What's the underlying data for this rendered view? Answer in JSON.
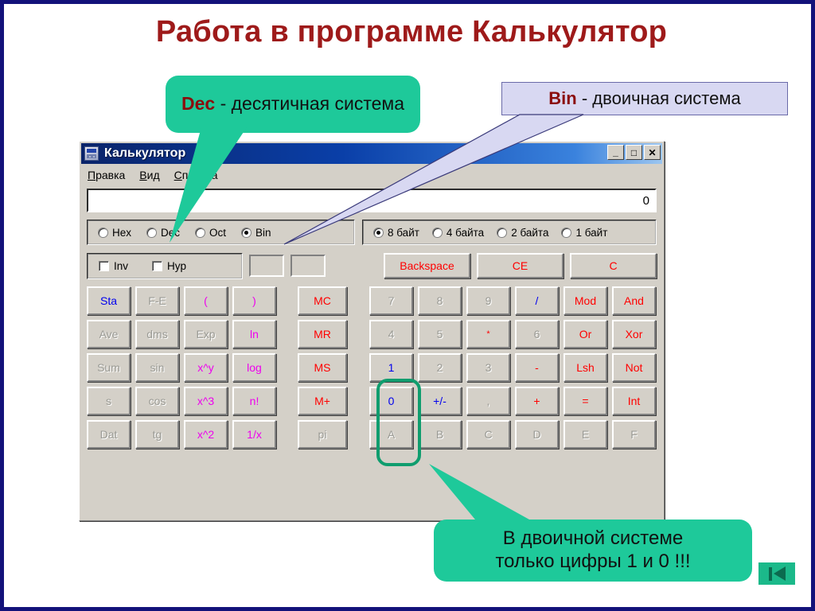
{
  "slide": {
    "title": "Работа в программе Калькулятор"
  },
  "callouts": {
    "dec": {
      "keyword": "Dec",
      "text": " - десятичная система"
    },
    "bin": {
      "keyword": "Bin",
      "text": " - двоичная система"
    },
    "binary_note_line1": "В двоичной системе",
    "binary_note_line2": "только цифры 1 и 0 !!!"
  },
  "calculator": {
    "titlebar": {
      "title": "Калькулятор",
      "icon": "calculator-icon",
      "minimize": "_",
      "maximize": "□",
      "close": "✕"
    },
    "menu": [
      {
        "accel": "П",
        "rest": "равка"
      },
      {
        "accel": "В",
        "rest": "ид"
      },
      {
        "accel": "С",
        "rest": "правка"
      }
    ],
    "display": {
      "value": "0"
    },
    "base_options": [
      {
        "label": "Hex",
        "selected": false
      },
      {
        "label": "Dec",
        "selected": false
      },
      {
        "label": "Oct",
        "selected": false
      },
      {
        "label": "Bin",
        "selected": true
      }
    ],
    "size_options": [
      {
        "label": "8 байт",
        "selected": true
      },
      {
        "label": "4 байта",
        "selected": false
      },
      {
        "label": "2 байта",
        "selected": false
      },
      {
        "label": "1 байт",
        "selected": false
      }
    ],
    "checkboxes": [
      {
        "label": "Inv",
        "checked": false
      },
      {
        "label": "Hyp",
        "checked": false
      }
    ],
    "indicators": [
      "",
      ""
    ],
    "action_buttons": [
      {
        "label": "Backspace",
        "color": "red"
      },
      {
        "label": "CE",
        "color": "red"
      },
      {
        "label": "C",
        "color": "red"
      }
    ],
    "keypad_rows": [
      [
        {
          "label": "Sta",
          "color": "blue",
          "group": "left"
        },
        {
          "label": "F-E",
          "color": "gray",
          "group": "left"
        },
        {
          "label": "(",
          "color": "magenta",
          "group": "left"
        },
        {
          "label": ")",
          "color": "magenta",
          "group": "left"
        },
        {
          "label": "MC",
          "color": "red",
          "group": "mem"
        },
        {
          "label": "7",
          "color": "gray",
          "group": "num"
        },
        {
          "label": "8",
          "color": "gray",
          "group": "num"
        },
        {
          "label": "9",
          "color": "gray",
          "group": "num"
        },
        {
          "label": "/",
          "color": "blue",
          "group": "num"
        },
        {
          "label": "Mod",
          "color": "red",
          "group": "logic"
        },
        {
          "label": "And",
          "color": "red",
          "group": "logic"
        }
      ],
      [
        {
          "label": "Ave",
          "color": "gray",
          "group": "left"
        },
        {
          "label": "dms",
          "color": "gray",
          "group": "left"
        },
        {
          "label": "Exp",
          "color": "gray",
          "group": "left"
        },
        {
          "label": "ln",
          "color": "magenta",
          "group": "left"
        },
        {
          "label": "MR",
          "color": "red",
          "group": "mem"
        },
        {
          "label": "4",
          "color": "gray",
          "group": "num"
        },
        {
          "label": "5",
          "color": "gray",
          "group": "num"
        },
        {
          "label": "*",
          "color": "red",
          "group": "num",
          "small": true
        },
        {
          "label": "6",
          "color": "gray",
          "group": "num"
        },
        {
          "label": "Or",
          "color": "red",
          "group": "logic"
        },
        {
          "label": "Xor",
          "color": "red",
          "group": "logic"
        }
      ],
      [
        {
          "label": "Sum",
          "color": "gray",
          "group": "left"
        },
        {
          "label": "sin",
          "color": "gray",
          "group": "left"
        },
        {
          "label": "x^y",
          "color": "magenta",
          "group": "left"
        },
        {
          "label": "log",
          "color": "magenta",
          "group": "left"
        },
        {
          "label": "MS",
          "color": "red",
          "group": "mem"
        },
        {
          "label": "1",
          "color": "blue",
          "group": "num"
        },
        {
          "label": "2",
          "color": "gray",
          "group": "num"
        },
        {
          "label": "3",
          "color": "gray",
          "group": "num"
        },
        {
          "label": "-",
          "color": "red",
          "group": "num"
        },
        {
          "label": "Lsh",
          "color": "red",
          "group": "logic"
        },
        {
          "label": "Not",
          "color": "red",
          "group": "logic"
        }
      ],
      [
        {
          "label": "s",
          "color": "gray",
          "group": "left"
        },
        {
          "label": "cos",
          "color": "gray",
          "group": "left"
        },
        {
          "label": "x^3",
          "color": "magenta",
          "group": "left"
        },
        {
          "label": "n!",
          "color": "magenta",
          "group": "left"
        },
        {
          "label": "M+",
          "color": "red",
          "group": "mem"
        },
        {
          "label": "0",
          "color": "blue",
          "group": "num"
        },
        {
          "label": "+/-",
          "color": "blue",
          "group": "num"
        },
        {
          "label": ",",
          "color": "gray",
          "group": "num"
        },
        {
          "label": "+",
          "color": "red",
          "group": "num"
        },
        {
          "label": "=",
          "color": "red",
          "group": "logic"
        },
        {
          "label": "Int",
          "color": "red",
          "group": "logic"
        }
      ],
      [
        {
          "label": "Dat",
          "color": "gray",
          "group": "left"
        },
        {
          "label": "tg",
          "color": "gray",
          "group": "left"
        },
        {
          "label": "x^2",
          "color": "magenta",
          "group": "left"
        },
        {
          "label": "1/x",
          "color": "magenta",
          "group": "left"
        },
        {
          "label": "pi",
          "color": "gray",
          "group": "mem"
        },
        {
          "label": "A",
          "color": "gray",
          "group": "num"
        },
        {
          "label": "B",
          "color": "gray",
          "group": "num"
        },
        {
          "label": "C",
          "color": "gray",
          "group": "num"
        },
        {
          "label": "D",
          "color": "gray",
          "group": "num"
        },
        {
          "label": "E",
          "color": "gray",
          "group": "logic"
        },
        {
          "label": "F",
          "color": "gray",
          "group": "logic"
        }
      ]
    ]
  },
  "navigation": {
    "first_slide": "skip-to-first-icon"
  },
  "colors": {
    "title": "#9e1a1a",
    "callout_green": "#1ec99a",
    "callout_lavender": "#d8d8f2",
    "highlight": "#0f9d6e",
    "window_face": "#d4d0c8",
    "key_blue": "#0000ee",
    "key_red": "#ff0000",
    "key_magenta": "#ee00ee",
    "key_disabled": "#9a9a94"
  }
}
